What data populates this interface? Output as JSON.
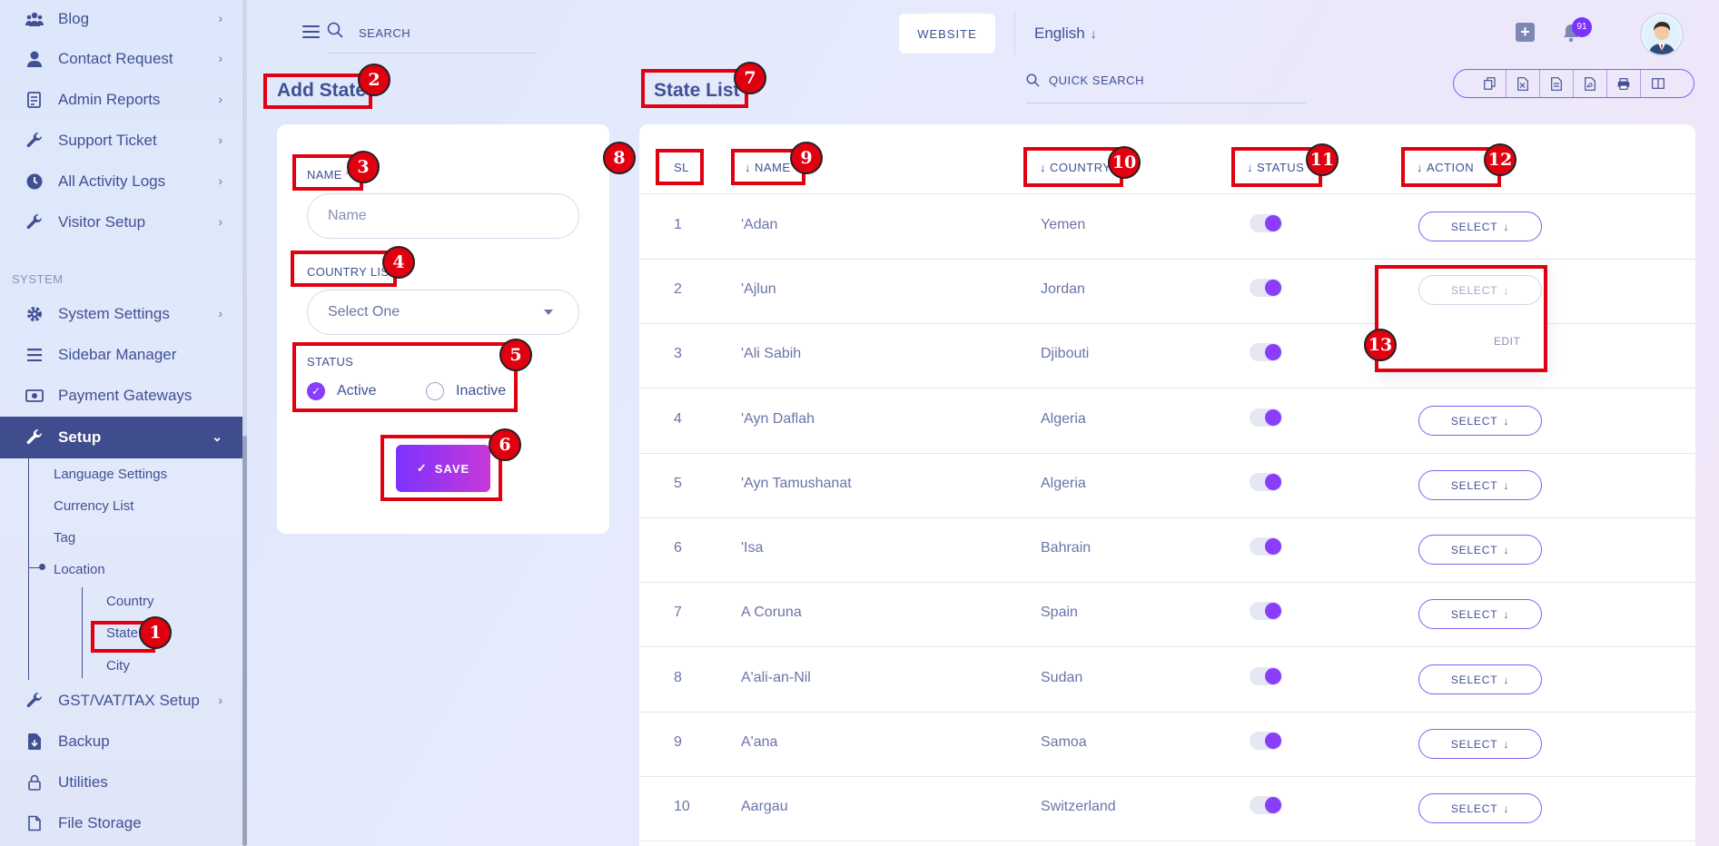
{
  "sidebar": {
    "items": [
      {
        "label": "Blog",
        "icon": "users-icon"
      },
      {
        "label": "Contact Request",
        "icon": "user-icon"
      },
      {
        "label": "Admin Reports",
        "icon": "report-icon"
      },
      {
        "label": "Support Ticket",
        "icon": "wrench-icon"
      },
      {
        "label": "All Activity Logs",
        "icon": "clock-icon"
      },
      {
        "label": "Visitor Setup",
        "icon": "wrench-icon"
      }
    ],
    "section_label": "SYSTEM",
    "system_items": [
      {
        "label": "System Settings",
        "icon": "gear-icon"
      },
      {
        "label": "Sidebar Manager",
        "icon": "bars-icon"
      },
      {
        "label": "Payment Gateways",
        "icon": "money-icon"
      }
    ],
    "active_item": {
      "label": "Setup",
      "icon": "wrench-icon"
    },
    "sub_items": [
      "Language Settings",
      "Currency List",
      "Tag",
      "Location"
    ],
    "location_children": [
      "Country",
      "State",
      "City"
    ],
    "bottom_items": [
      {
        "label": "GST/VAT/TAX Setup",
        "icon": "wrench-icon"
      },
      {
        "label": "Backup",
        "icon": "file-download-icon"
      },
      {
        "label": "Utilities",
        "icon": "lock-icon"
      },
      {
        "label": "File Storage",
        "icon": "file-icon"
      }
    ]
  },
  "header": {
    "search_label": "SEARCH",
    "website_button": "WEBSITE",
    "language": "English",
    "notification_count": "91"
  },
  "add_state": {
    "title": "Add State",
    "name_label": "NAME",
    "required_mark": "*",
    "name_placeholder": "Name",
    "country_label": "COUNTRY LIST",
    "country_placeholder": "Select One",
    "status_label": "STATUS",
    "status_active": "Active",
    "status_inactive": "Inactive",
    "save_label": "SAVE"
  },
  "state_list": {
    "title": "State List",
    "quick_search": "QUICK SEARCH",
    "columns": [
      "SL",
      "NAME",
      "COUNTRY",
      "STATUS",
      "ACTION"
    ],
    "select_label": "SELECT",
    "edit_label": "EDIT",
    "rows": [
      {
        "sl": "1",
        "name": "'Adan",
        "country": "Yemen"
      },
      {
        "sl": "2",
        "name": "'Ajlun",
        "country": "Jordan"
      },
      {
        "sl": "3",
        "name": "'Ali Sabih",
        "country": "Djibouti"
      },
      {
        "sl": "4",
        "name": "'Ayn Daflah",
        "country": "Algeria"
      },
      {
        "sl": "5",
        "name": "'Ayn Tamushanat",
        "country": "Algeria"
      },
      {
        "sl": "6",
        "name": "'Isa",
        "country": "Bahrain"
      },
      {
        "sl": "7",
        "name": "A Coruna",
        "country": "Spain"
      },
      {
        "sl": "8",
        "name": "A'ali-an-Nil",
        "country": "Sudan"
      },
      {
        "sl": "9",
        "name": "A'ana",
        "country": "Samoa"
      },
      {
        "sl": "10",
        "name": "Aargau",
        "country": "Switzerland"
      }
    ]
  },
  "annotations": [
    "1",
    "2",
    "3",
    "4",
    "5",
    "6",
    "7",
    "8",
    "9",
    "10",
    "11",
    "12",
    "13"
  ],
  "colors": {
    "accent": "#7c32ff",
    "primary_text": "#415094",
    "sidebar_active": "#3f4d8f",
    "annotation": "#e0000f"
  }
}
